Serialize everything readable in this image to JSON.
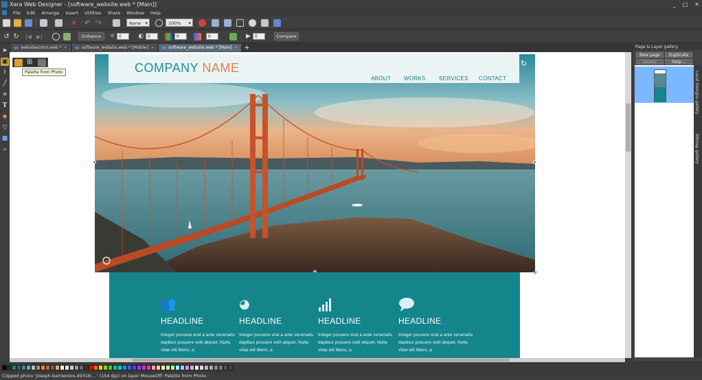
{
  "window": {
    "title": "Xara Web Designer - [software_website.web * [Main]]",
    "controls": [
      "_",
      "□",
      "✕"
    ]
  },
  "menubar": {
    "items": [
      "File",
      "Edit",
      "Arrange",
      "Insert",
      "Utilities",
      "Share",
      "Window",
      "Help"
    ]
  },
  "toolbar1": {
    "fill_combo": "None",
    "zoom_combo": "100%"
  },
  "toolbar2": {
    "enhance_label": "Enhance",
    "brightness_value": "0",
    "contrast_value": "0",
    "saturation_value": "0",
    "temperature_value": "0",
    "play_value": "0",
    "compare_label": "Compare"
  },
  "tabs": [
    {
      "label": "websitesintro.web *",
      "active": false
    },
    {
      "label": "software_website.web * [Mobile]",
      "active": false
    },
    {
      "label": "software_website.web * [Main]",
      "active": true
    }
  ],
  "tooltip": "Palette from Photo",
  "website": {
    "company_part1": "COMPANY",
    "company_part2": "NAME",
    "nav": [
      "ABOUT",
      "WORKS",
      "SERVICES",
      "CONTACT"
    ],
    "features": [
      {
        "icon": "users-icon",
        "headline": "HEADLINE",
        "body": "Integer posuere erat a ante venenatis dapibus posuere velit aliquet. Nulla vitae elit libero, a"
      },
      {
        "icon": "pie-chart-icon",
        "headline": "HEADLINE",
        "body": "Integer posuere erat a ante venenatis dapibus posuere velit aliquet. Nulla vitae elit libero, a"
      },
      {
        "icon": "bar-chart-icon",
        "headline": "HEADLINE",
        "body": "Integer posuere erat a ante venenatis dapibus posuere velit aliquet. Nulla vitae elit libero, a"
      },
      {
        "icon": "speech-bubble-icon",
        "headline": "HEADLINE",
        "body": "Integer posuere erat a ante venenatis dapibus posuere velit aliquet. Nulla vitae elit libero, a"
      }
    ],
    "colors": {
      "teal": "#15858c",
      "orange": "#e0824a",
      "header_bg": "#eaf4f4"
    }
  },
  "right_panel": {
    "title": "Page & Layer gallery",
    "new_page": "New page",
    "duplicate": "Duplicate",
    "delete": "Delete",
    "help": "Help...",
    "side_tab1": "Local Designs gallery",
    "side_tab2": "Bitmap gallery"
  },
  "palette": [
    "#000000",
    "#2b2b2b",
    "#15858c",
    "#1a6f75",
    "#3c8a8f",
    "#6aa9ad",
    "#9ec8ca",
    "#c97f56",
    "#e0824a",
    "#b86a3e",
    "#8a5a3a",
    "#d0b090",
    "#ffffff",
    "#e6e6e6",
    "#cccccc",
    "#999999",
    "#666666",
    "#333333",
    "#ff0000",
    "#ff6600",
    "#ffcc00",
    "#99cc00",
    "#33cc33",
    "#00cc66",
    "#00cccc",
    "#0099ff",
    "#3366ff",
    "#6633ff",
    "#9933ff",
    "#cc33cc",
    "#ff3399",
    "#ff99cc",
    "#ffcc99",
    "#ffff99",
    "#ccff99",
    "#99ffcc",
    "#99ffff",
    "#99ccff",
    "#cc99ff",
    "#ff99ff",
    "#eeeeee",
    "#dddddd",
    "#bbbbbb",
    "#aaaaaa",
    "#888888",
    "#777777",
    "#555555",
    "#444444"
  ],
  "status": "Clipped photo 'joseph-barrientos-49318-...' (154 dpi) on layer MouseOff: Palette from Photo"
}
